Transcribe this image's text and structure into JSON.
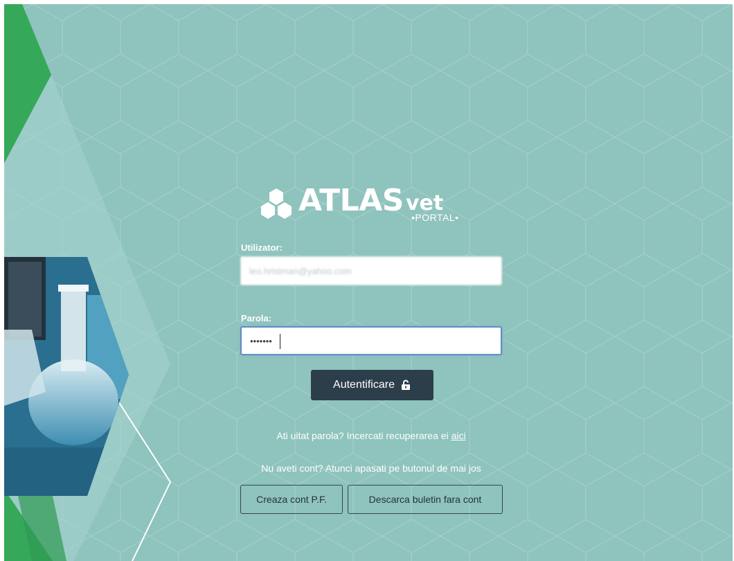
{
  "brand": {
    "name": "ATLAS",
    "suffix": "vet",
    "subtitle": "•PORTAL•"
  },
  "login": {
    "username_label": "Utilizator:",
    "username_value": "leo.hristman@yahoo.com",
    "password_label": "Parola:",
    "password_value": "•••••••",
    "submit_label": "Autentificare"
  },
  "forgot": {
    "text": "Ati uitat parola? Incercati recuperarea ei",
    "link": "aici"
  },
  "signup": {
    "prompt": "Nu aveti cont? Atunci apasati pe butonul de mai jos",
    "create_account": "Creaza cont P.F.",
    "download_without_account": "Descarca buletin fara cont"
  },
  "colors": {
    "background": "#8fc3bd",
    "accent_green": "#35a85a",
    "button_dark": "#2d3e4b",
    "text": "#ffffff"
  },
  "icons": {
    "submit": "unlock-icon",
    "logo": "hexagon-cluster-icon"
  }
}
